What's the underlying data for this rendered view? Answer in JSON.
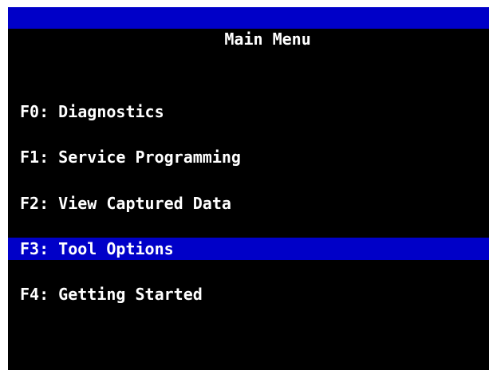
{
  "window": {
    "title": "Main Menu"
  },
  "menu": {
    "items": [
      {
        "label": "F0: Diagnostics",
        "selected": false
      },
      {
        "label": "F1: Service Programming",
        "selected": false
      },
      {
        "label": "F2: View Captured Data",
        "selected": false
      },
      {
        "label": "F3: Tool Options",
        "selected": true
      },
      {
        "label": "F4: Getting Started",
        "selected": false
      }
    ]
  },
  "colors": {
    "background": "#000000",
    "highlight": "#0000c8",
    "text": "#ffffff"
  }
}
